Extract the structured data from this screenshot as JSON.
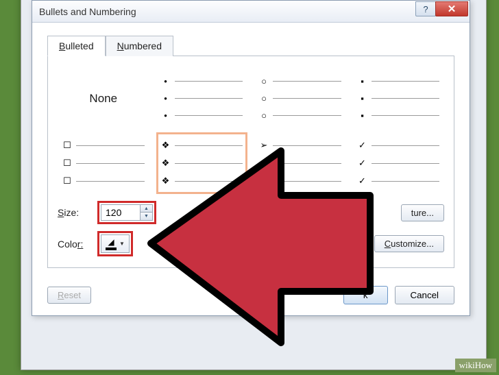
{
  "window": {
    "title": "Bullets and Numbering",
    "help": "?",
    "close": "✕"
  },
  "tabs": {
    "bulleted": "ulleted",
    "bulleted_u": "B",
    "numbered": "umbered",
    "numbered_u": "N"
  },
  "bullets": {
    "none": "None",
    "styles": [
      "•",
      "○",
      "▪",
      "☐",
      "❖",
      "➢",
      "✓"
    ]
  },
  "controls": {
    "size_label": "ize:",
    "size_u": "S",
    "size_value": "120",
    "color_label": "r:",
    "color_u": "Colo"
  },
  "buttons": {
    "picture": "ture...",
    "customize": "ustomize...",
    "customize_u": "C",
    "reset": "eset",
    "reset_u": "R",
    "ok": "k",
    "cancel": "Cancel"
  },
  "watermark": "wikiHow"
}
